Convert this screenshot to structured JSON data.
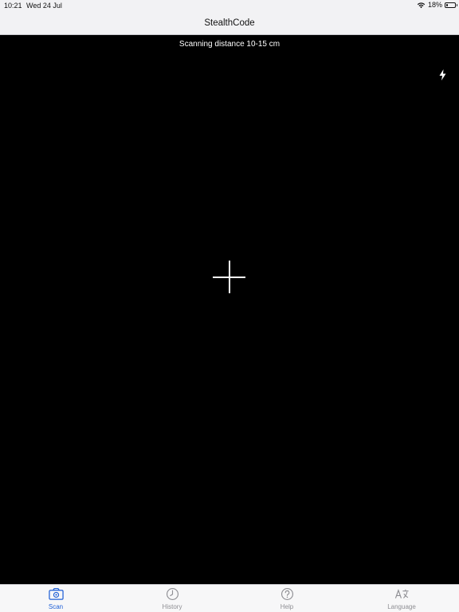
{
  "status_bar": {
    "time": "10:21",
    "date": "Wed 24 Jul",
    "battery_percent": "18%",
    "battery_level": 0.18
  },
  "nav": {
    "title": "StealthCode"
  },
  "camera": {
    "hint": "Scanning distance 10-15 cm",
    "flash_icon": "lightning-bolt-icon",
    "crosshair_icon": "plus-crosshair-icon"
  },
  "tabs": [
    {
      "label": "Scan",
      "icon": "camera-scan-icon",
      "active": true
    },
    {
      "label": "History",
      "icon": "clock-icon",
      "active": false
    },
    {
      "label": "Help",
      "icon": "question-circle-icon",
      "active": false
    },
    {
      "label": "Language",
      "icon": "translate-icon",
      "active": false
    }
  ],
  "colors": {
    "accent": "#1f5fd6",
    "inactive": "#8e8e93",
    "camera_bg": "#000000",
    "bar_bg": "#f2f2f4"
  }
}
